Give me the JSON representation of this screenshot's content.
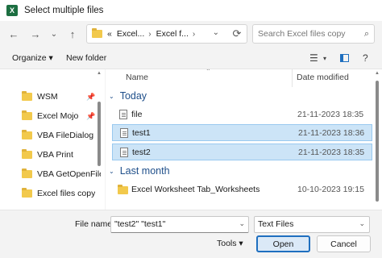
{
  "window": {
    "title": "Select multiple files",
    "app_icon": "excel-icon"
  },
  "nav": {
    "back": "←",
    "forward": "→",
    "recent": "⌄",
    "up": "↑",
    "address": {
      "overflow": "«",
      "segments": [
        "Excel...",
        "Excel f..."
      ],
      "separator": "›"
    },
    "refresh": "⟳",
    "search_placeholder": "Search Excel files copy"
  },
  "toolbar": {
    "organize": "Organize ▾",
    "new_folder": "New folder"
  },
  "sidebar": {
    "items": [
      {
        "label": "WSM",
        "pinned": true
      },
      {
        "label": "Excel Mojo",
        "pinned": true
      },
      {
        "label": "VBA FileDialog",
        "pinned": false
      },
      {
        "label": "VBA Print",
        "pinned": false
      },
      {
        "label": "VBA GetOpenFileNa",
        "pinned": false
      },
      {
        "label": "Excel files copy",
        "pinned": false
      }
    ]
  },
  "list": {
    "columns": {
      "name": "Name",
      "date": "Date modified"
    },
    "groups": [
      {
        "label": "Today",
        "files": [
          {
            "name": "file",
            "date": "21-11-2023 18:35",
            "selected": false
          },
          {
            "name": "test1",
            "date": "21-11-2023 18:36",
            "selected": true
          },
          {
            "name": "test2",
            "date": "21-11-2023 18:35",
            "selected": true
          }
        ]
      },
      {
        "label": "Last month",
        "files": [
          {
            "name": "Excel Worksheet Tab_Worksheets",
            "date": "10-10-2023 19:15",
            "selected": false,
            "folder": true
          }
        ]
      }
    ]
  },
  "footer": {
    "file_name_label": "File name:",
    "file_name_value": "\"test2\" \"test1\"",
    "file_type": "Text Files",
    "tools": "Tools ▾",
    "open": "Open",
    "cancel": "Cancel"
  },
  "colors": {
    "selection": "#cce4f7",
    "group_text": "#1f4f8a",
    "accent": "#1f6fbf"
  }
}
